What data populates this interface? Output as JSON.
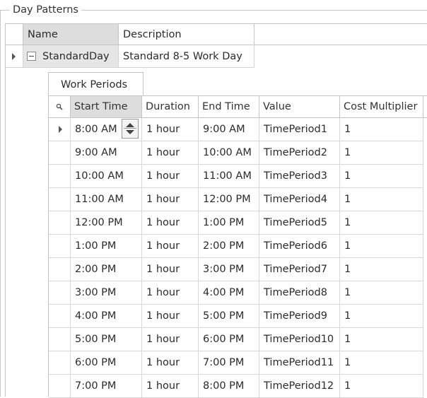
{
  "group": {
    "title": "Day Patterns"
  },
  "master": {
    "columns": [
      "Name",
      "Description"
    ],
    "row": {
      "name": "StandardDay",
      "description": "Standard 8-5 Work Day"
    }
  },
  "detail": {
    "tab_label": "Work Periods",
    "columns": [
      "Start Time",
      "Duration",
      "End Time",
      "Value",
      "Cost Multiplier"
    ],
    "rows": [
      [
        "8:00 AM",
        "1 hour",
        "9:00 AM",
        "TimePeriod1",
        "1"
      ],
      [
        "9:00 AM",
        "1 hour",
        "10:00 AM",
        "TimePeriod2",
        "1"
      ],
      [
        "10:00 AM",
        "1 hour",
        "11:00 AM",
        "TimePeriod3",
        "1"
      ],
      [
        "11:00 AM",
        "1 hour",
        "12:00 PM",
        "TimePeriod4",
        "1"
      ],
      [
        "12:00 PM",
        "1 hour",
        "1:00 PM",
        "TimePeriod5",
        "1"
      ],
      [
        "1:00 PM",
        "1 hour",
        "2:00 PM",
        "TimePeriod6",
        "1"
      ],
      [
        "2:00 PM",
        "1 hour",
        "3:00 PM",
        "TimePeriod7",
        "1"
      ],
      [
        "3:00 PM",
        "1 hour",
        "4:00 PM",
        "TimePeriod8",
        "1"
      ],
      [
        "4:00 PM",
        "1 hour",
        "5:00 PM",
        "TimePeriod9",
        "1"
      ],
      [
        "5:00 PM",
        "1 hour",
        "6:00 PM",
        "TimePeriod10",
        "1"
      ],
      [
        "6:00 PM",
        "1 hour",
        "7:00 PM",
        "TimePeriod11",
        "1"
      ],
      [
        "7:00 PM",
        "1 hour",
        "8:00 PM",
        "TimePeriod12",
        "1"
      ]
    ]
  },
  "icons": {
    "filter": "magnifier-icon",
    "focused_row": "row-indicator-icon",
    "spinner": "spin-updown-icon",
    "collapse": "collapse-minus-icon"
  },
  "colors": {
    "border": "#c6c6c6",
    "selected_header": "#dddddd"
  }
}
